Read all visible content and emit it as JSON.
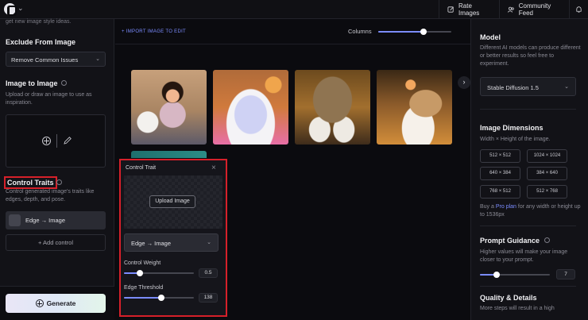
{
  "topbar": {
    "rate_label": "Rate Images",
    "feed_label": "Community Feed"
  },
  "left": {
    "cutoff_text": "get new image style ideas.",
    "exclude": {
      "title": "Exclude From Image",
      "select_value": "Remove Common Issues"
    },
    "image_to_image": {
      "title": "Image to Image",
      "desc": "Upload or draw an image to use as inspiration."
    },
    "control_traits": {
      "title": "Control Traits",
      "desc": "Control generated image's traits like edges, depth, and pose.",
      "item_label": "Edge → Image",
      "add_label": "+ Add control"
    },
    "generate_label": "Generate"
  },
  "center": {
    "import_label": "+ IMPORT IMAGE TO EDIT",
    "columns_label": "Columns",
    "columns_value": 0.62,
    "next_label": "›"
  },
  "control_panel": {
    "title": "Control Trait",
    "close": "×",
    "upload_label": "Upload Image",
    "select_value": "Edge → Image",
    "weight_label": "Control Weight",
    "weight_value": "0.5",
    "threshold_label": "Edge Threshold",
    "threshold_value": "138"
  },
  "right": {
    "model": {
      "title": "Model",
      "desc": "Different AI models can produce different or better results so feel free to experiment.",
      "select_value": "Stable Diffusion 1.5"
    },
    "dimensions": {
      "title": "Image Dimensions",
      "desc": "Width × Height of the image.",
      "options": [
        "512 × 512",
        "1024 × 1024",
        "640 × 384",
        "384 × 640",
        "768 × 512",
        "512 × 768"
      ],
      "note_prefix": "Buy a ",
      "note_link": "Pro plan",
      "note_suffix": " for any width or height up to 1536px"
    },
    "guidance": {
      "title": "Prompt Guidance",
      "desc": "Higher values will make your image closer to your prompt.",
      "value": "7"
    },
    "quality": {
      "title": "Quality & Details",
      "desc": "More steps will result in a high"
    }
  }
}
